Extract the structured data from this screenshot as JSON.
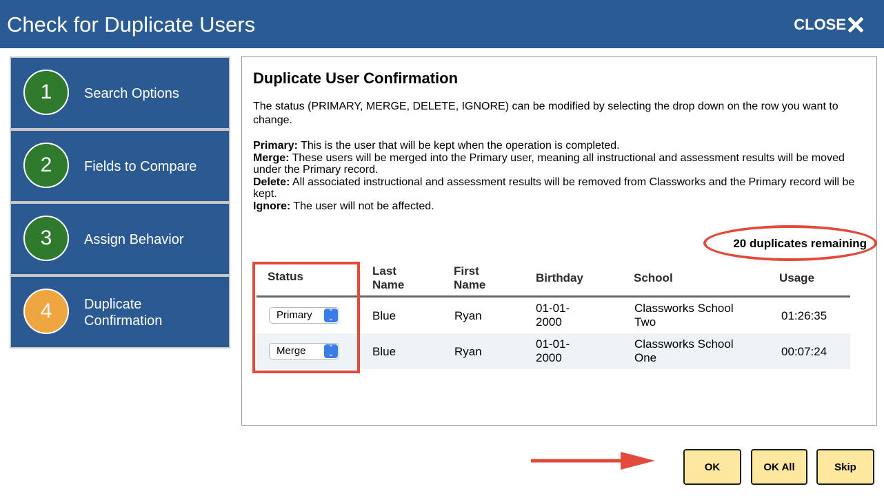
{
  "window": {
    "title": "Check for Duplicate Users",
    "close_label": "CLOSE",
    "close_icon": "x-icon"
  },
  "steps": [
    {
      "number": "1",
      "label_line1": "Search Options",
      "label_line2": "",
      "status": "complete",
      "color": "#2f7b2e"
    },
    {
      "number": "2",
      "label_line1": "Fields to Compare",
      "label_line2": "",
      "status": "complete",
      "color": "#2f7b2e"
    },
    {
      "number": "3",
      "label_line1": "Assign Behavior",
      "label_line2": "",
      "status": "complete",
      "color": "#2f7b2e"
    },
    {
      "number": "4",
      "label_line1": "Duplicate",
      "label_line2": "Confirmation",
      "status": "current",
      "color": "#f0a640"
    }
  ],
  "confirmation": {
    "heading": "Duplicate User Confirmation",
    "description": "The status (PRIMARY, MERGE, DELETE, IGNORE) can be modified by selecting the drop down on the row you want to change.",
    "definitions": [
      {
        "term": "Primary:",
        "text": " This is the user that will be kept when the operation is completed."
      },
      {
        "term": "Merge:",
        "text": " These users will be merged into the Primary user, meaning all instructional and assessment results will be moved under the Primary record."
      },
      {
        "term": "Delete:",
        "text": " All associated instructional and assessment results will be removed from Classworks and the Primary record will be kept."
      },
      {
        "term": "Ignore:",
        "text": " The user will not be affected."
      }
    ],
    "remaining": "20 duplicates remaining"
  },
  "table": {
    "headers": {
      "status": "Status",
      "last_name_1": "Last",
      "last_name_2": "Name",
      "first_name_1": "First",
      "first_name_2": "Name",
      "birthday": "Birthday",
      "school": "School",
      "usage": "Usage"
    },
    "rows": [
      {
        "status": "Primary",
        "last": "Blue",
        "first": "Ryan",
        "birthday_1": "01-01-",
        "birthday_2": "2000",
        "school_1": "Classworks School",
        "school_2": "Two",
        "usage": "01:26:35"
      },
      {
        "status": "Merge",
        "last": "Blue",
        "first": "Ryan",
        "birthday_1": "01-01-",
        "birthday_2": "2000",
        "school_1": "Classworks School",
        "school_2": "One",
        "usage": "00:07:24"
      }
    ]
  },
  "buttons": {
    "ok": "OK",
    "ok_all": "OK All",
    "skip": "Skip"
  },
  "colors": {
    "header_bg": "#2b5b94",
    "step_bg": "#2b5a92",
    "step_complete": "#2f7b2e",
    "step_current": "#f0a640",
    "button_bg": "#fde89e",
    "annotation_red": "#e24a3b",
    "select_arrow": "#3a7de6"
  }
}
